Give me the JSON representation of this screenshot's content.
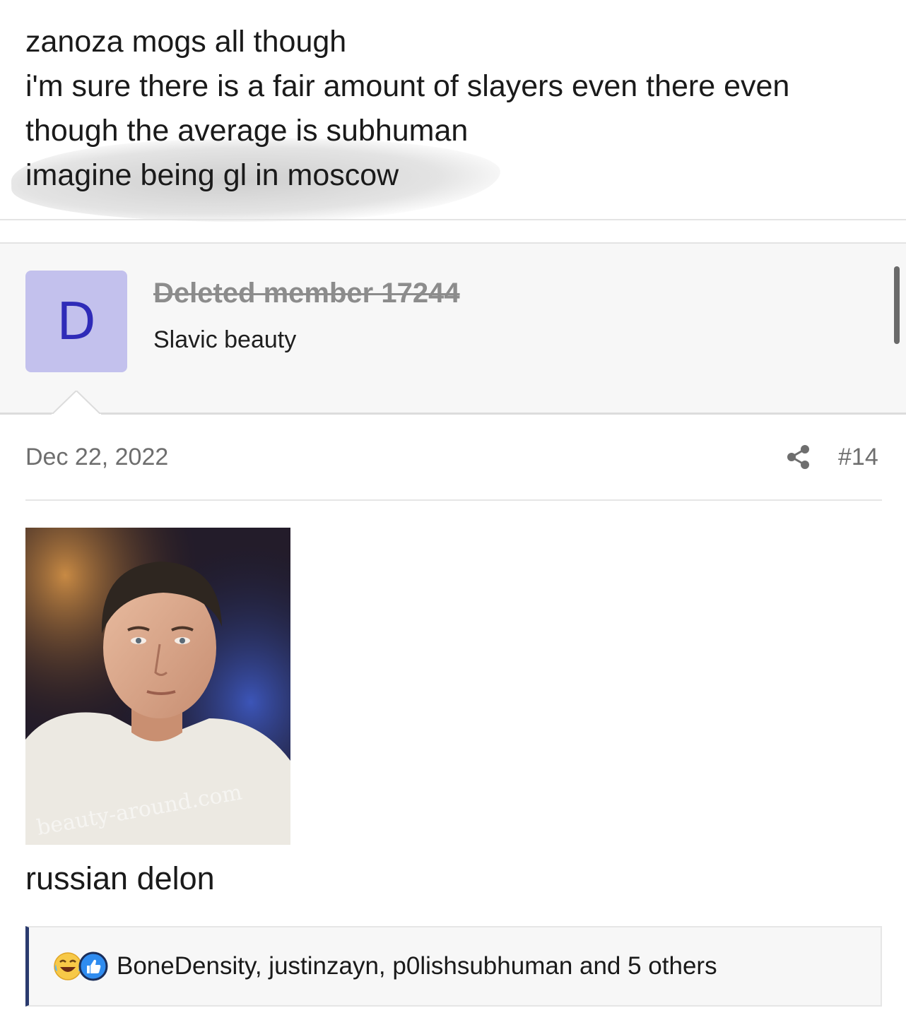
{
  "previous_post": {
    "lines": [
      "zanoza mogs all though",
      "i'm sure there is a fair amount of slayers even there even",
      "though the average is subhuman",
      "imagine being gl in moscow"
    ]
  },
  "author": {
    "avatar_letter": "D",
    "avatar_color": "#c3c1ed",
    "username": "Deleted member 17244",
    "user_title": "Slavic beauty"
  },
  "post": {
    "date": "Dec 22, 2022",
    "number": "#14",
    "image_watermark": "beauty-around.com",
    "caption": "russian delon"
  },
  "reactions": {
    "icons": [
      "laughing-crying-emoji-icon",
      "like-thumbs-up-icon"
    ],
    "text": "BoneDensity, justinzayn, p0lishsubhuman and 5 others"
  },
  "colors": {
    "accent_bar": "#2b3b6e",
    "meta_text": "#6e6e6e",
    "deleted_username": "#8c8c8c"
  }
}
